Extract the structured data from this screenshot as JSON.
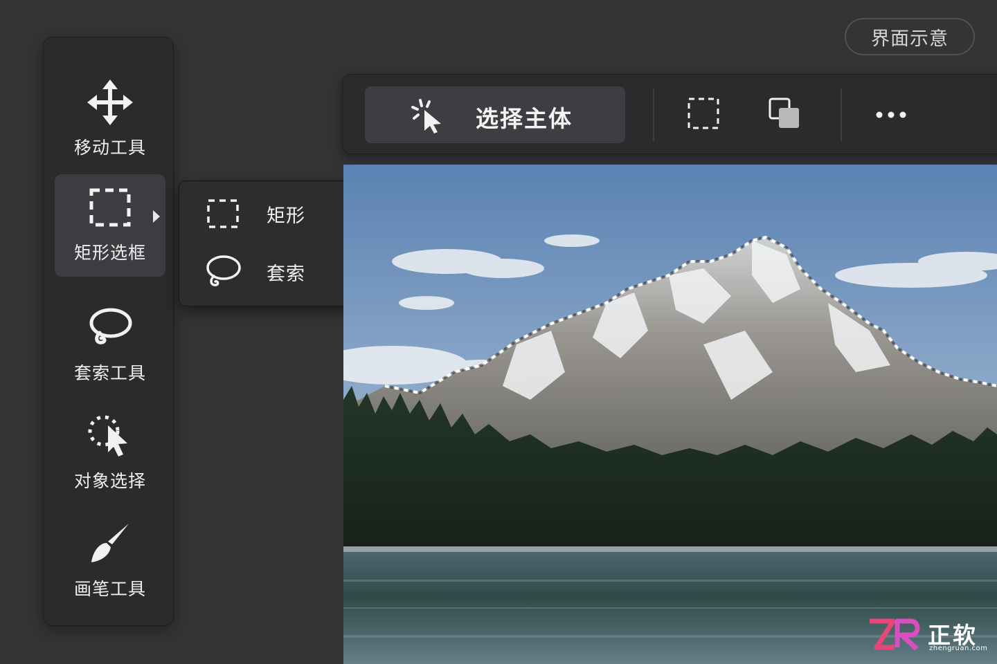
{
  "badge": {
    "label": "界面示意"
  },
  "tools": [
    {
      "label": "移动工具",
      "icon": "move-icon"
    },
    {
      "label": "矩形选框",
      "icon": "marquee-rect-icon"
    },
    {
      "label": "套索工具",
      "icon": "lasso-icon"
    },
    {
      "label": "对象选择",
      "icon": "object-select-icon"
    },
    {
      "label": "画笔工具",
      "icon": "brush-icon"
    }
  ],
  "active_tool": "矩形选框",
  "flyout": {
    "items": [
      {
        "label": "矩形",
        "icon": "marquee-rect-icon"
      },
      {
        "label": "套索",
        "icon": "lasso-icon"
      }
    ]
  },
  "toolbar": {
    "select_subject_label": "选择主体",
    "select_subject_icon": "magic-cursor-icon",
    "buttons": [
      "marquee-rect-icon",
      "overlap-squares-icon",
      "more-icon"
    ]
  },
  "canvas": {
    "image": "mountain-lake-photo",
    "selection": "dashed-outline-around-mountain"
  },
  "watermark": {
    "logo": "ZR",
    "text": "正软",
    "sub": "zhengruan.com"
  },
  "colors": {
    "background": "#333436",
    "panel": "#2a2b2d",
    "active": "#3c3d40",
    "text": "#f2f2f2"
  }
}
